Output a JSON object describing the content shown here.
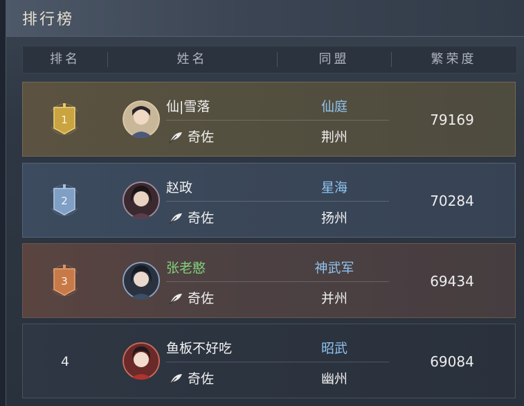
{
  "title": "排行榜",
  "headers": {
    "rank": "排名",
    "name": "姓名",
    "alliance": "同盟",
    "prosperity": "繁荣度"
  },
  "rows": [
    {
      "rank": "1",
      "name": "仙|雪落",
      "role": "奇佐",
      "alliance": "仙庭",
      "region": "荆州",
      "prosperity": "79169",
      "badge_color": "#c9a440"
    },
    {
      "rank": "2",
      "name": "赵政",
      "role": "奇佐",
      "alliance": "星海",
      "region": "扬州",
      "prosperity": "70284",
      "badge_color": "#7f9fc4"
    },
    {
      "rank": "3",
      "name": "张老憨",
      "role": "奇佐",
      "alliance": "神武军",
      "region": "并州",
      "prosperity": "69434",
      "badge_color": "#c77a48"
    },
    {
      "rank": "4",
      "name": "鱼板不好吃",
      "role": "奇佐",
      "alliance": "昭武",
      "region": "幽州",
      "prosperity": "69084"
    }
  ]
}
